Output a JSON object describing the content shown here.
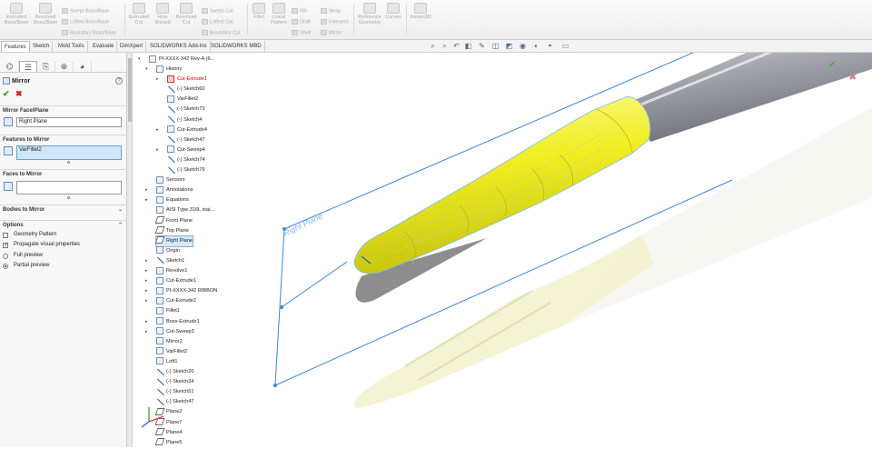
{
  "ribbon": {
    "buttons": [
      {
        "label": "Extruded Boss/Base",
        "line1": "Extruded",
        "line2": "Boss/Base"
      },
      {
        "label": "Revolved Boss/Base",
        "line1": "Revolved",
        "line2": "Boss/Base"
      },
      {
        "label": "Extruded Cut",
        "line1": "Extruded",
        "line2": "Cut"
      },
      {
        "label": "Hole Wizard",
        "line1": "Hole",
        "line2": "Wizard"
      },
      {
        "label": "Revolved Cut",
        "line1": "Revolved",
        "line2": "Cut"
      },
      {
        "label": "Fillet",
        "line1": "Fillet",
        "line2": ""
      },
      {
        "label": "Linear Pattern",
        "line1": "Linear",
        "line2": "Pattern"
      },
      {
        "label": "Reference Geometry",
        "line1": "Reference",
        "line2": "Geometry"
      },
      {
        "label": "Curves",
        "line1": "Curves",
        "line2": ""
      },
      {
        "label": "Instant3D",
        "line1": "Instant3D",
        "line2": ""
      }
    ],
    "small": {
      "swept_boss": "Swept Boss/Base",
      "lofted_boss": "Lofted Boss/Base",
      "boundary_boss": "Boundary Boss/Base",
      "swept_cut": "Swept Cut",
      "lofted_cut": "Lofted Cut",
      "boundary_cut": "Boundary Cut",
      "rib": "Rib",
      "wrap": "Wrap",
      "draft": "Draft",
      "intersect": "Intersect",
      "shell": "Shell",
      "mirror": "Mirror"
    }
  },
  "tabs": [
    "Features",
    "Sketch",
    "Mold Tools",
    "Evaluate",
    "DimXpert",
    "SOLIDWORKS Add-Ins",
    "SOLIDWORKS MBD"
  ],
  "property_manager": {
    "title": "Mirror",
    "help": "?",
    "ok": "✔",
    "cancel": "✖",
    "mirror_face_plane": {
      "header": "Mirror Face/Plane",
      "value": "Right Plane"
    },
    "features_to_mirror": {
      "header": "Features to Mirror",
      "value": "VarFillet2"
    },
    "faces_to_mirror": {
      "header": "Faces to Mirror",
      "value": ""
    },
    "bodies_to_mirror": {
      "header": "Bodies to Mirror"
    },
    "options": {
      "header": "Options",
      "geometry_pattern": "Geometry Pattern",
      "geometry_pattern_checked": false,
      "propagate_visual": "Propagate visual properties",
      "propagate_visual_checked": true,
      "full_preview": "Full preview",
      "partial_preview": "Partial preview",
      "preview_selected": "partial"
    }
  },
  "tree": {
    "root": "PI-XXXX-342 Rev-A (6...",
    "items": [
      {
        "label": "History",
        "kind": "folder",
        "expandable": true,
        "expanded": true
      },
      {
        "label": "Cut-Extrude1",
        "kind": "error",
        "expandable": true
      },
      {
        "label": "(-) Sketch60",
        "kind": "sketch"
      },
      {
        "label": "VarFillet2",
        "kind": "feature"
      },
      {
        "label": "(-) Sketch73",
        "kind": "sketch"
      },
      {
        "label": "(-) Sketch4",
        "kind": "sketch"
      },
      {
        "label": "Cut-Extrude4",
        "kind": "feature",
        "expandable": true
      },
      {
        "label": "(-) Sketch47",
        "kind": "sketch"
      },
      {
        "label": "Cut-Sweep4",
        "kind": "feature",
        "expandable": true
      },
      {
        "label": "(-) Sketch74",
        "kind": "sketch"
      },
      {
        "label": "(-) Sketch79",
        "kind": "sketch"
      },
      {
        "label": "Sensors",
        "kind": "folder"
      },
      {
        "label": "Annotations",
        "kind": "folder",
        "expandable": true
      },
      {
        "label": "Equations",
        "kind": "folder",
        "expandable": true
      },
      {
        "label": "AISI Type 316L stai...",
        "kind": "feature"
      },
      {
        "label": "Front Plane",
        "kind": "plane"
      },
      {
        "label": "Top Plane",
        "kind": "plane"
      },
      {
        "label": "Right Plane",
        "kind": "plane",
        "highlight": true
      },
      {
        "label": "Origin",
        "kind": "feature"
      },
      {
        "label": "Sketch1",
        "kind": "sketch",
        "expandable": true
      },
      {
        "label": "Revolve1",
        "kind": "feature",
        "expandable": true
      },
      {
        "label": "Cut-Extrude1",
        "kind": "feature",
        "expandable": true
      },
      {
        "label": "PI-XXXX-342 RIBBON",
        "kind": "feature",
        "expandable": true
      },
      {
        "label": "Cut-Extrude2",
        "kind": "feature",
        "expandable": true
      },
      {
        "label": "Fillet1",
        "kind": "feature"
      },
      {
        "label": "Boss-Extrude1",
        "kind": "feature",
        "expandable": true
      },
      {
        "label": "Cut-Sweep3",
        "kind": "feature",
        "expandable": true
      },
      {
        "label": "Mirror2",
        "kind": "feature"
      },
      {
        "label": "VarFillet2",
        "kind": "feature"
      },
      {
        "label": "Loft1",
        "kind": "feature"
      },
      {
        "label": "(-) Sketch20",
        "kind": "sketch"
      },
      {
        "label": "(-) Sketch34",
        "kind": "sketch"
      },
      {
        "label": "(-) Sketch51",
        "kind": "sketch"
      },
      {
        "label": "(-) Sketch47",
        "kind": "sketch"
      },
      {
        "label": "Plane2",
        "kind": "plane"
      },
      {
        "label": "Plane7",
        "kind": "plane"
      },
      {
        "label": "Plane4",
        "kind": "plane"
      },
      {
        "label": "Plane5",
        "kind": "plane"
      }
    ]
  },
  "viewport": {
    "plane_label": "Right Plane",
    "confirm": "✔",
    "cancel": "✖",
    "colors": {
      "part_yellow": "#f2f02a",
      "plane_blue": "#3d86d6",
      "shaft_grey": "#8d8f96"
    }
  }
}
